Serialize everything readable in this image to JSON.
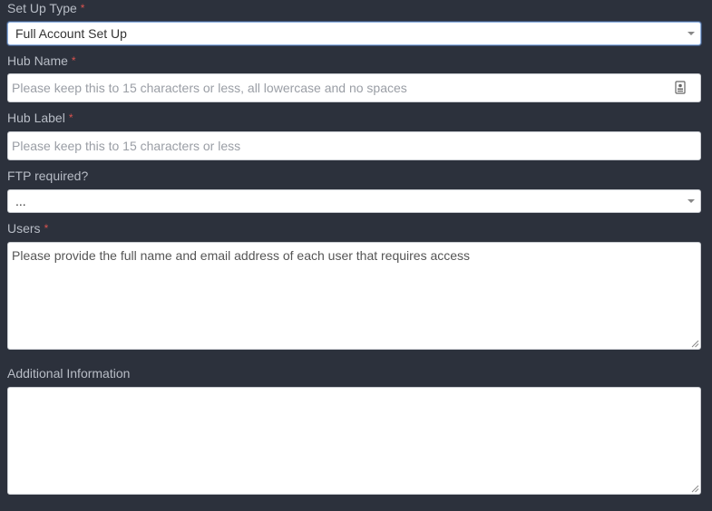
{
  "form": {
    "setup_type": {
      "label": "Set Up Type",
      "required_mark": "*",
      "value": "Full Account Set Up"
    },
    "hub_name": {
      "label": "Hub Name",
      "required_mark": "*",
      "placeholder": "Please keep this to 15 characters or less, all lowercase and no spaces",
      "icon": "contact-card-icon"
    },
    "hub_label": {
      "label": "Hub Label",
      "required_mark": "*",
      "placeholder": "Please keep this to 15 characters or less"
    },
    "ftp_required": {
      "label": "FTP required?",
      "value": "..."
    },
    "users": {
      "label": "Users",
      "required_mark": "*",
      "placeholder": "Please provide the full name and email address of each user that requires access"
    },
    "additional_info": {
      "label": "Additional Information",
      "value": ""
    }
  },
  "colors": {
    "background": "#2c313c",
    "label": "#b8bdc6",
    "required": "#d9534f",
    "field_bg": "#ffffff"
  }
}
